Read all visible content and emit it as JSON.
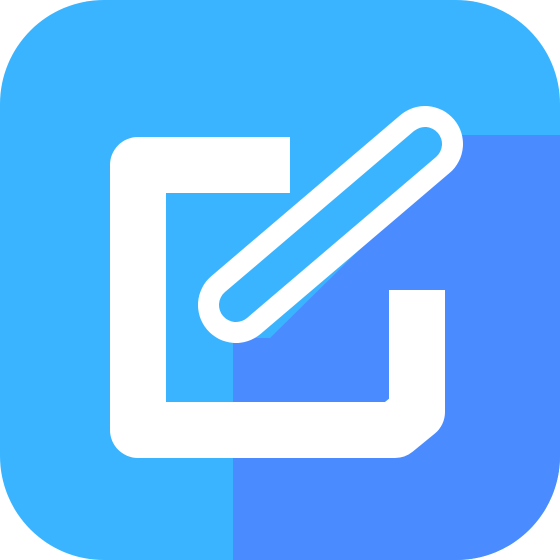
{
  "icon": {
    "name": "edit-icon",
    "colors": {
      "light_blue": "#3BB4FF",
      "dark_blue": "#4A8CFF",
      "white": "#FFFFFF"
    }
  }
}
